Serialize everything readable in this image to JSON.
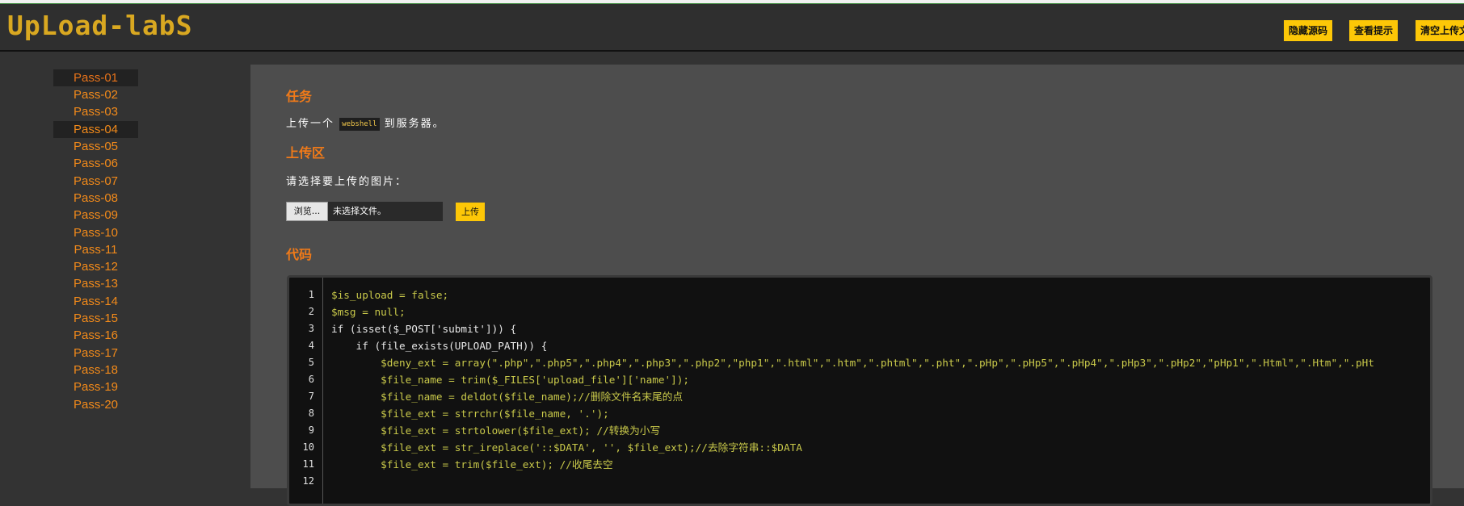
{
  "header": {
    "logo": "UpLoad-labS",
    "buttons": [
      "隐藏源码",
      "查看提示",
      "清空上传文件"
    ]
  },
  "sidebar": {
    "items": [
      "Pass-01",
      "Pass-02",
      "Pass-03",
      "Pass-04",
      "Pass-05",
      "Pass-06",
      "Pass-07",
      "Pass-08",
      "Pass-09",
      "Pass-10",
      "Pass-11",
      "Pass-12",
      "Pass-13",
      "Pass-14",
      "Pass-15",
      "Pass-16",
      "Pass-17",
      "Pass-18",
      "Pass-19",
      "Pass-20"
    ],
    "highlighted": [
      "Pass-01",
      "Pass-04"
    ]
  },
  "main": {
    "task_title": "任务",
    "task_text_before": "上传一个",
    "task_code": "webshell",
    "task_text_after": "到服务器。",
    "upload_title": "上传区",
    "upload_prompt": "请选择要上传的图片：",
    "browse_label": "浏览...",
    "no_file_label": "未选择文件。",
    "upload_button": "上传",
    "code_title": "代码"
  },
  "code": {
    "line_numbers": [
      "1",
      "2",
      "3",
      "4",
      "5",
      "6",
      "7",
      "8",
      "9",
      "10",
      "11",
      "12"
    ],
    "lines": [
      "$is_upload = false;",
      "$msg = null;",
      "if (isset($_POST['submit'])) {",
      "    if (file_exists(UPLOAD_PATH)) {",
      "        $deny_ext = array(\".php\",\".php5\",\".php4\",\".php3\",\".php2\",\"php1\",\".html\",\".htm\",\".phtml\",\".pht\",\".pHp\",\".pHp5\",\".pHp4\",\".pHp3\",\".pHp2\",\"pHp1\",\".Html\",\".Htm\",\".pHt",
      "        $file_name = trim($_FILES['upload_file']['name']);",
      "        $file_name = deldot($file_name);//删除文件名末尾的点",
      "        $file_ext = strrchr($file_name, '.');",
      "        $file_ext = strtolower($file_ext); //转换为小写",
      "        $file_ext = str_ireplace('::$DATA', '', $file_ext);//去除字符串::$DATA",
      "        $file_ext = trim($file_ext); //收尾去空",
      ""
    ]
  },
  "colors": {
    "accent_orange": "#f07a19",
    "button_yellow": "#fdc707",
    "background": "#333333",
    "panel": "#4d4d4d",
    "code_bg": "#111111"
  }
}
